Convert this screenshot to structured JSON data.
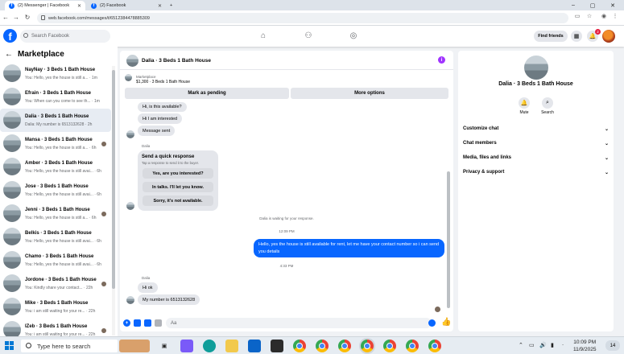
{
  "browser": {
    "tabs": [
      {
        "label": "(2) Messenger | Facebook",
        "active": true
      },
      {
        "label": "(2) Facebook",
        "active": false
      }
    ],
    "url": "web.facebook.com/messages/t/6512384478885309",
    "new_tab": "+",
    "win_min": "–",
    "win_max": "▢",
    "win_close": "✕"
  },
  "fb": {
    "logo": "f",
    "search_placeholder": "Search Facebook",
    "find_friends": "Find friends",
    "notif_count": "2",
    "nav_icons": [
      "home-icon",
      "groups-icon",
      "gaming-icon"
    ]
  },
  "left": {
    "title": "Marketplace",
    "conversations": [
      {
        "name": "NayNay · 3 Beds 1 Bath House",
        "msg": "You: Hello, yes the house is still a... · 1m",
        "active": false,
        "mini": false
      },
      {
        "name": "Efrain · 3 Beds 1 Bath House",
        "msg": "You: When can you come to see th... · 1m",
        "active": false,
        "mini": false
      },
      {
        "name": "Dalia · 3 Beds 1 Bath House",
        "msg": "Dalia: My number is 6513132628 · 2h",
        "active": true,
        "mini": false
      },
      {
        "name": "Mansa · 3 Beds 1 Bath House",
        "msg": "You: Hello, yes the house is still a... · 6h",
        "active": false,
        "mini": true
      },
      {
        "name": "Amber · 3 Beds 1 Bath House",
        "msg": "You: Hello, yes the house is still avai... · 6h",
        "active": false,
        "mini": false
      },
      {
        "name": "Jose · 3 Beds 1 Bath House",
        "msg": "You: Hello, yes the house is still avai... · 6h",
        "active": false,
        "mini": false
      },
      {
        "name": "Jenni · 3 Beds 1 Bath House",
        "msg": "You: Hello, yes the house is still a... · 6h",
        "active": false,
        "mini": true
      },
      {
        "name": "Belkis · 3 Beds 1 Bath House",
        "msg": "You: Hello, yes the house is still avai... · 6h",
        "active": false,
        "mini": false
      },
      {
        "name": "Chamo · 3 Beds 1 Bath House",
        "msg": "You: Hello, yes the house is still avai... · 6h",
        "active": false,
        "mini": false
      },
      {
        "name": "Jordone · 3 Beds 1 Bath House",
        "msg": "You: Kindly share your contact... · 22h",
        "active": false,
        "mini": true
      },
      {
        "name": "Mike · 3 Beds 1 Bath House",
        "msg": "You: i am still waiting for your re... · 22h",
        "active": false,
        "mini": false
      },
      {
        "name": "IZeb · 3 Beds 1 Bath House",
        "msg": "You: i am still waiting for your re... · 22h",
        "active": false,
        "mini": true
      }
    ]
  },
  "chat": {
    "title": "Dalia · 3 Beds 1 Bath House",
    "listing_label": "Marketplace",
    "listing_item": "$1,300 · 3 Beds 1 Bath House",
    "mark_pending": "Mark as pending",
    "more_options": "More options",
    "msg_available": "Hi, is this available?",
    "msg_interested": "Hi I am interested",
    "msg_sent": "Message sent",
    "sender": "Dalia",
    "quick_title": "Send a quick response",
    "quick_sub": "Tap a response to send it to the buyer.",
    "quick_1": "Yes, are you interested?",
    "quick_2": "In talks. I'll let you know.",
    "quick_3": "Sorry, it's not available.",
    "waiting_note": "Dalia is waiting for your response.",
    "time_1": "12:09 PM",
    "outgoing": "Hello, yes the house is still available for rent, let me have your contact number so i can send you  details",
    "time_2": "4:33 PM",
    "sender_2": "Dalia",
    "msg_hiok": "Hi ok",
    "msg_number": "My number is 6513132628",
    "composer_placeholder": "Aa",
    "like": "👍"
  },
  "right": {
    "name": "Dalia · 3 Beds 1 Bath House",
    "mute": "Mute",
    "search": "Search",
    "rows": [
      "Customize chat",
      "Chat members",
      "Media, files and links",
      "Privacy & support"
    ]
  },
  "taskbar": {
    "search_placeholder": "Type here to search",
    "time": "10:09 PM",
    "date": "11/9/2025",
    "notif": "14"
  }
}
